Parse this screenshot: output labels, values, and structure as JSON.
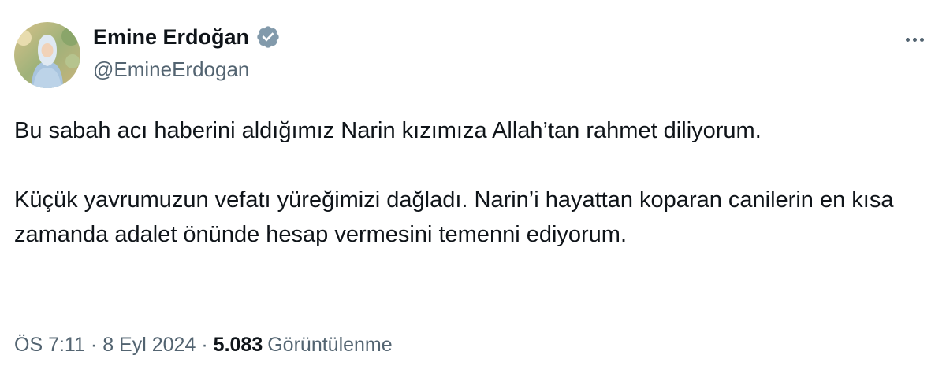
{
  "author": {
    "display_name": "Emine Erdoğan",
    "handle": "@EmineErdogan",
    "verified_icon": "verified-badge-icon",
    "verified_color": "#829aab"
  },
  "menu": {
    "icon": "more-options-icon"
  },
  "tweet": {
    "paragraphs": [
      "Bu sabah acı haberini aldığımız Narin kızımıza Allah’tan rahmet diliyorum.",
      "Küçük yavrumuzun vefatı yüreğimizi dağladı. Narin’i hayattan koparan canilerin en kısa zamanda adalet önünde hesap vermesini temenni ediyorum."
    ]
  },
  "meta": {
    "time": "ÖS 7:11",
    "separator": "·",
    "date": "8 Eyl 2024",
    "views_count": "5.083",
    "views_label": "Görüntülenme"
  },
  "colors": {
    "text_primary": "#0f1419",
    "text_secondary": "#536471",
    "background": "#ffffff"
  }
}
